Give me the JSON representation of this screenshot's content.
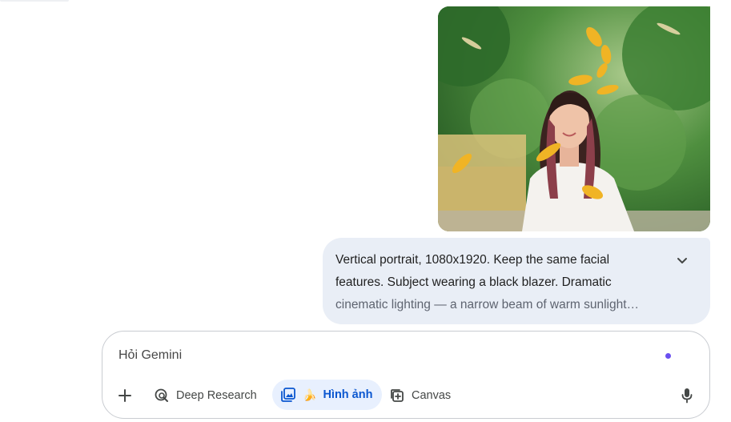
{
  "uploaded_image": {
    "alt": "",
    "colors": {
      "foliage": "#3f8a37",
      "leaf": "#f0b425",
      "shirt": "#f4f2ee"
    }
  },
  "user_prompt": {
    "line1": "Vertical portrait, 1080x1920. Keep the same facial",
    "line2": "features. Subject wearing a black blazer. Dramatic",
    "line3": "cinematic lighting — a narrow beam of warm sunlight…",
    "expand_icon": "chevron-down-icon"
  },
  "composer": {
    "placeholder": "Hỏi Gemini",
    "value": "",
    "tools": {
      "add_icon": "plus-icon",
      "deep_research_label": "Deep Research",
      "image_label": "Hình ảnh",
      "image_emoji": "🍌",
      "canvas_label": "Canvas",
      "mic_icon": "microphone-icon"
    },
    "accent": "#0b57d0",
    "dot_color": "#6a4ff0"
  }
}
